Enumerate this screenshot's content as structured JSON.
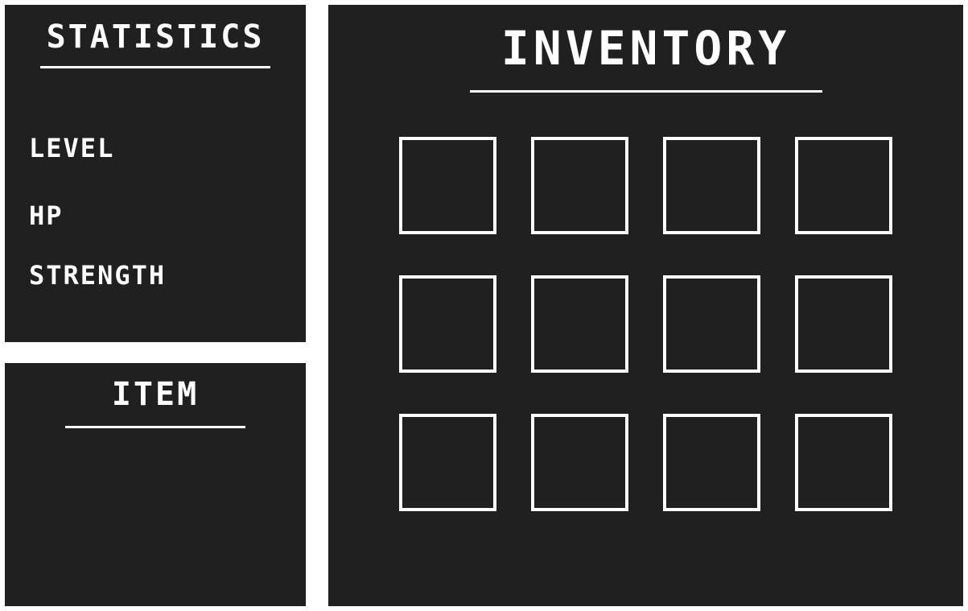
{
  "statistics": {
    "title": "STATISTICS",
    "rows": [
      {
        "label": "LEVEL"
      },
      {
        "label": "HP"
      },
      {
        "label": "STRENGTH"
      }
    ]
  },
  "item": {
    "title": "ITEM"
  },
  "inventory": {
    "title": "INVENTORY",
    "rows": 3,
    "columns": 4
  },
  "colors": {
    "panel_background": "#202020",
    "page_background": "#ffffff",
    "foreground": "#ffffff"
  }
}
